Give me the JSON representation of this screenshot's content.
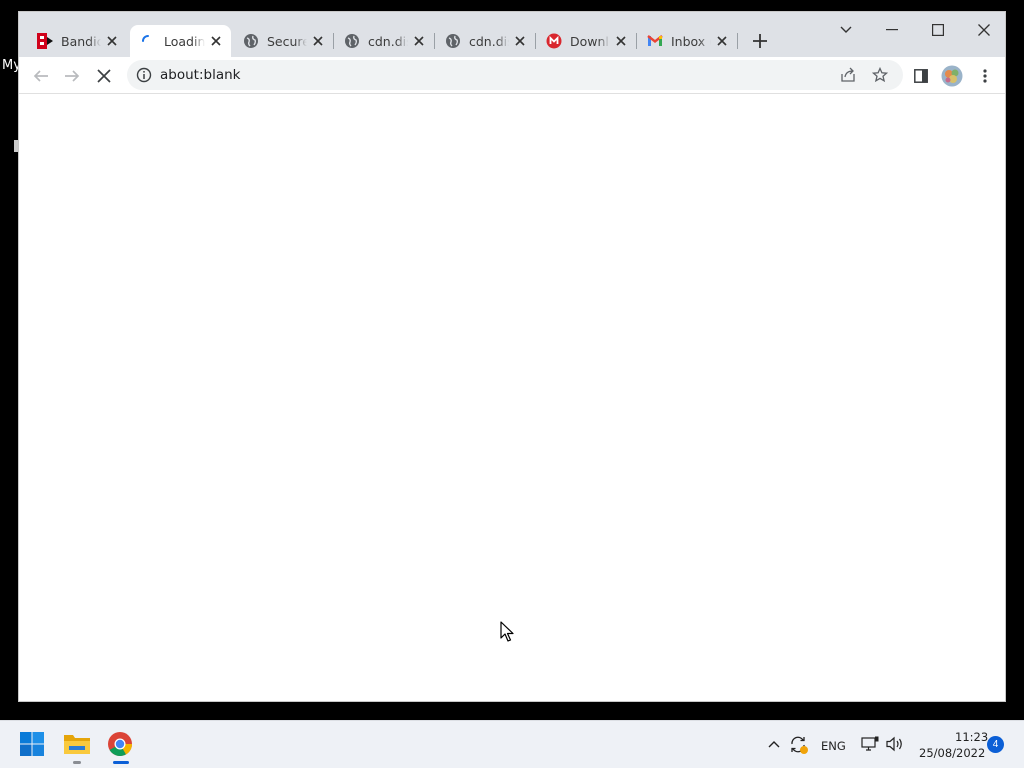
{
  "desktop": {
    "label": "My"
  },
  "browser": {
    "tabs": [
      {
        "title": "Bandica",
        "favicon": "bandicam-icon"
      },
      {
        "title": "Loading...",
        "favicon": "loading-spinner-icon",
        "active": true
      },
      {
        "title": "Secure",
        "favicon": "globe-icon"
      },
      {
        "title": "cdn.dis",
        "favicon": "globe-icon"
      },
      {
        "title": "cdn.dis",
        "favicon": "globe-icon"
      },
      {
        "title": "Downlo",
        "favicon": "mega-icon"
      },
      {
        "title": "Inbox (",
        "favicon": "gmail-icon"
      }
    ],
    "address": "about:blank",
    "loading": true
  },
  "taskbar": {
    "language": "ENG",
    "time": "11:23",
    "date": "25/08/2022",
    "notification_count": "4"
  },
  "colors": {
    "titlebar": "#dee1e6",
    "omnibox": "#f1f3f4",
    "taskbar": "#eef1f6",
    "accent": "#0b5fd6"
  }
}
